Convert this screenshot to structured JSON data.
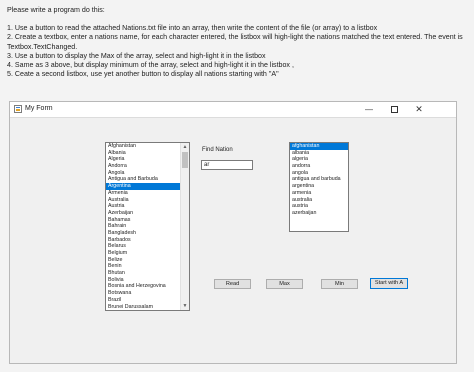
{
  "instructions": {
    "intro": "Please write a program do this:",
    "lines": [
      "1. Use a button to read the attached Nations.txt file into an array, then write the content of the file (or array) to a listbox",
      "2. Create a textbox, enter a nations name, for each character entered, the listbox will high-light the nations matched the text entered.  The event is",
      "Textbox.TextChanged.",
      "3. Use a button to display the Max of the array, select and high-light it in the listbox",
      "4. Same as 3 above, but display minimum of the array, select and high-light it in the listbox ,",
      "5. Ceate a second listbox, use yet another button to display all nations starting with \"A\""
    ]
  },
  "window": {
    "title": "My Form",
    "controls": {
      "minimize": "—",
      "maximize": "",
      "close": "✕"
    }
  },
  "nations_listbox": {
    "items": [
      "Afghanistan",
      "Albania",
      "Algeria",
      "Andorra",
      "Angola",
      "Antigua and Barbuda",
      "Argentina",
      "Armenia",
      "Australia",
      "Austria",
      "Azerbaijan",
      "Bahamas",
      "Bahrain",
      "Bangladesh",
      "Barbados",
      "Belarus",
      "Belgium",
      "Belize",
      "Benin",
      "Bhutan",
      "Bolivia",
      "Bosnia and Herzegovina",
      "Botswana",
      "Brazil",
      "Brunei Darussalam"
    ],
    "selected_index": 6
  },
  "find": {
    "label": "Find Nation",
    "value": "ar"
  },
  "a_listbox": {
    "items": [
      "afghanistan",
      "albania",
      "algeria",
      "andorra",
      "angola",
      "antigua and barbuda",
      "argentina",
      "armenia",
      "australia",
      "austria",
      "azerbaijan"
    ],
    "selected_index": 0
  },
  "buttons": {
    "read": "Read",
    "max": "Max",
    "min": "Min",
    "start_with_a": "Start with A"
  },
  "colors": {
    "selection": "#0078d7",
    "window_bg": "#f0f0f0",
    "page_bg": "#f3f3f3"
  }
}
